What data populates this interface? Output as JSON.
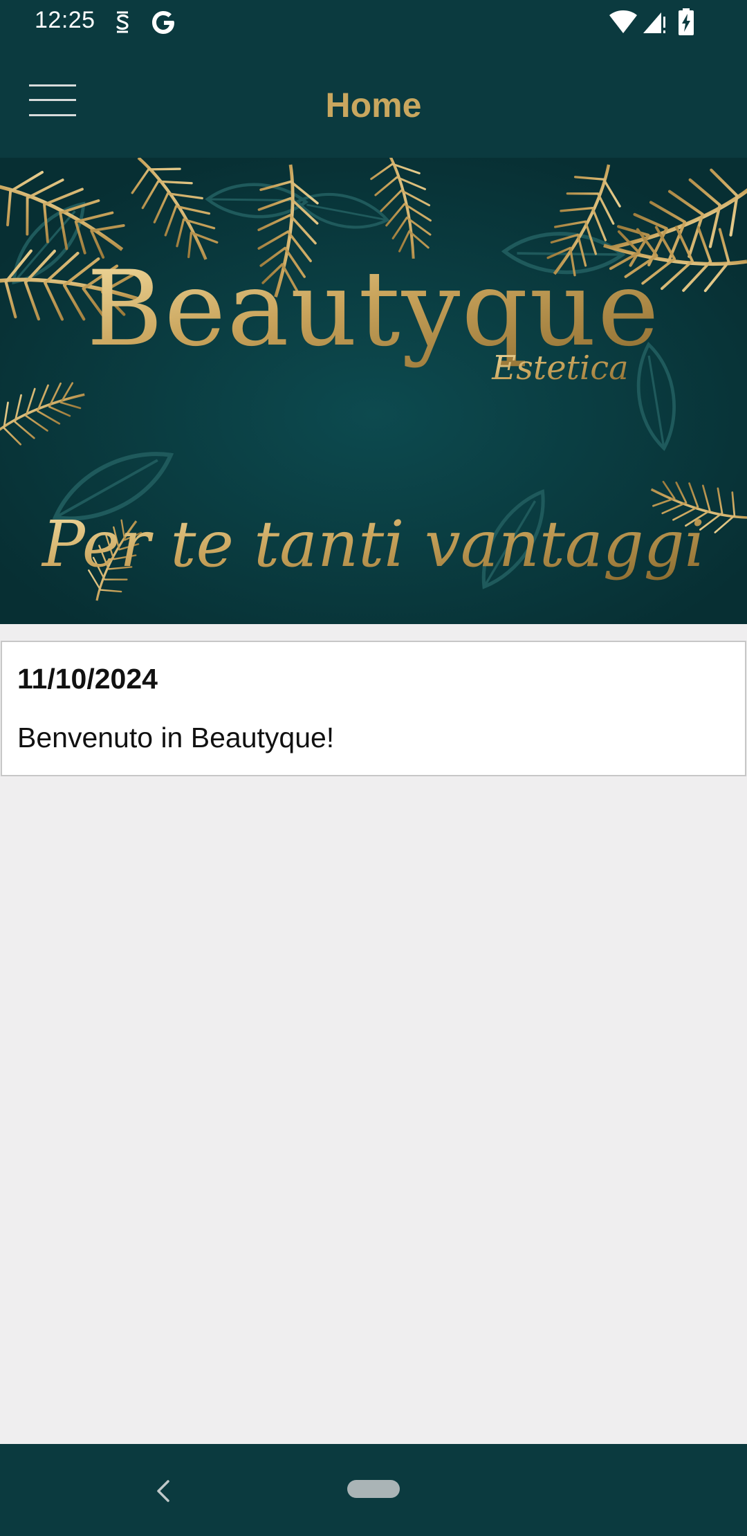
{
  "status_bar": {
    "time": "12:25",
    "icons": [
      "sync-app-icon",
      "google-icon",
      "wifi-icon",
      "cell-signal-icon",
      "battery-charging-icon"
    ]
  },
  "app_bar": {
    "title": "Home",
    "menu_icon": "hamburger-menu-icon"
  },
  "banner": {
    "brand_name": "Beautyque",
    "brand_sub": "Estetica",
    "tagline": "Per te tanti vantaggi"
  },
  "news": [
    {
      "date": "11/10/2024",
      "message": "Benvenuto in Beautyque!"
    }
  ],
  "nav_bar": {
    "icons": [
      "back-chevron-icon",
      "home-pill-icon"
    ]
  },
  "colors": {
    "primary_dark": "#0b3a3f",
    "accent_gold": "#c9a75f",
    "background": "#efeeef",
    "card": "#ffffff"
  }
}
